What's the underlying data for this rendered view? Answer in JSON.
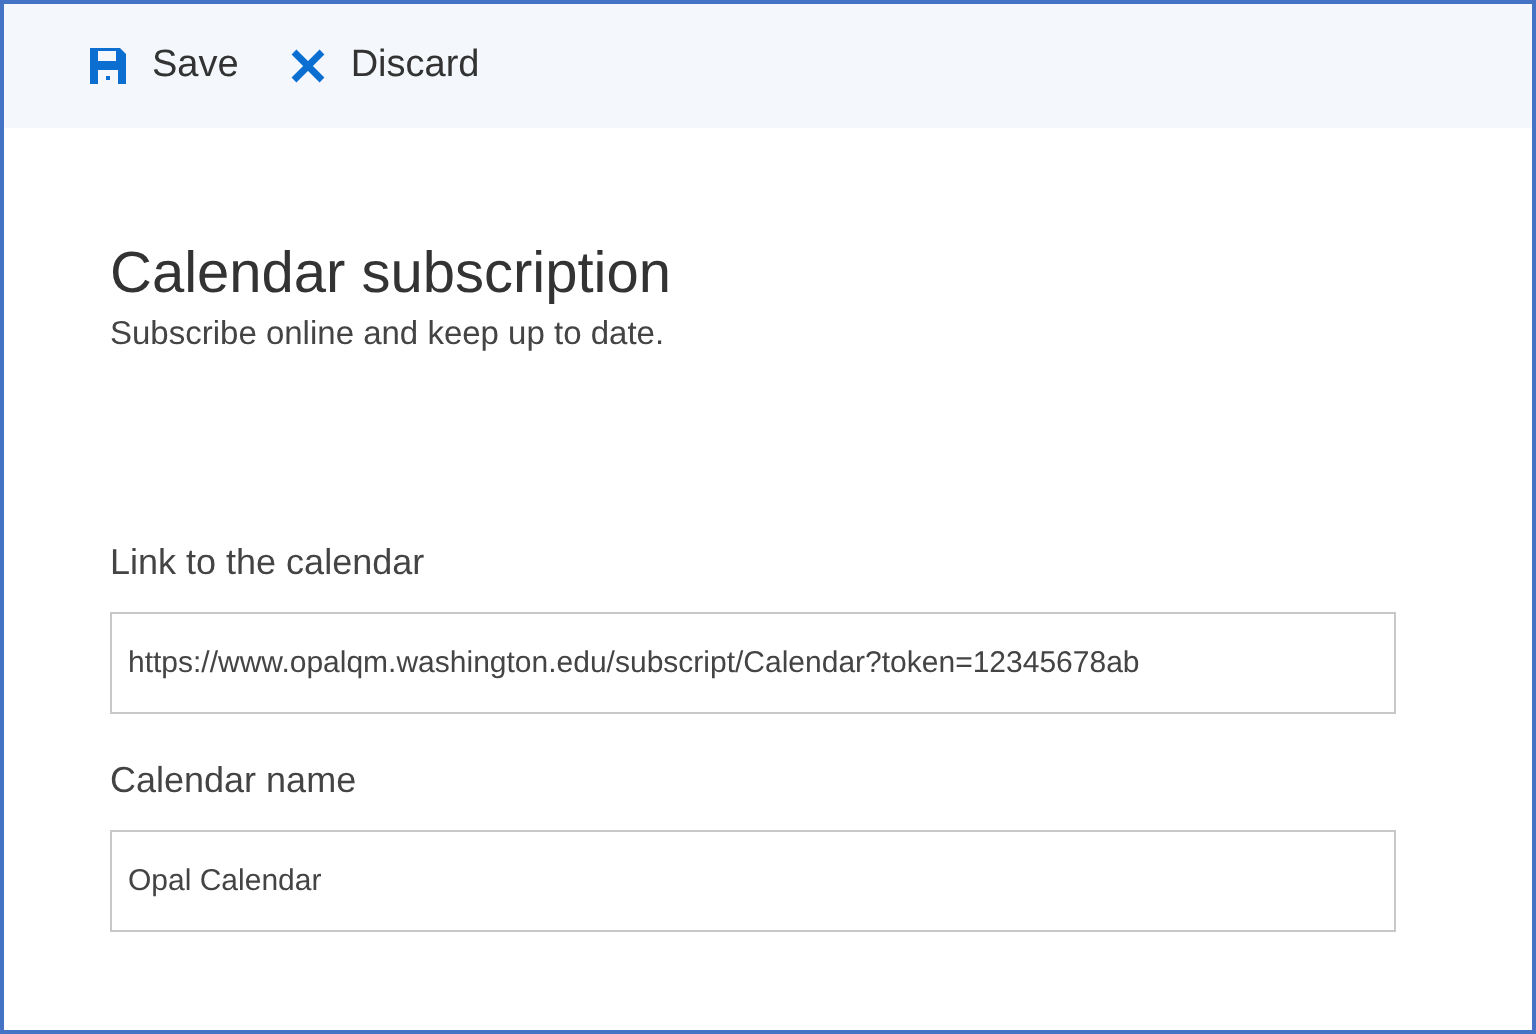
{
  "toolbar": {
    "buttons": [
      {
        "kind": "save",
        "label": "Save"
      },
      {
        "kind": "discard",
        "label": "Discard"
      }
    ]
  },
  "heading": {
    "title": "Calendar subscription",
    "subtitle": "Subscribe online and keep up to date."
  },
  "fields": [
    {
      "label": "Link to the calendar",
      "value": "https://www.opalqm.washington.edu/subscript/Calendar?token=12345678ab"
    },
    {
      "label": "Calendar name",
      "value": "Opal Calendar"
    }
  ]
}
